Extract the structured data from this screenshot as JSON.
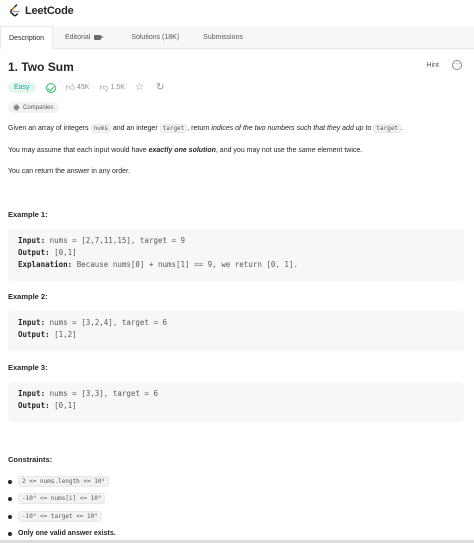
{
  "header": {
    "logo_text": "LeetCode"
  },
  "tabs": [
    {
      "label": "Description"
    },
    {
      "label": "Editorial"
    },
    {
      "label": "Solutions (18K)"
    },
    {
      "label": "Submissions"
    }
  ],
  "problem": {
    "title": "1. Two Sum",
    "hint_label": "Hint",
    "difficulty": "Easy",
    "likes": "45K",
    "dislikes": "1.5K",
    "companies_label": "Companies"
  },
  "description": {
    "p1_a": "Given an array of integers ",
    "p1_code1": "nums",
    "p1_b": " and an integer ",
    "p1_code2": "target",
    "p1_c": ", return ",
    "p1_em": "indices of the two numbers such that they add up to ",
    "p1_code3": "target",
    "p1_d": ".",
    "p2_a": "You may assume that each input would have ",
    "p2_strong": "exactly one solution",
    "p2_b": ", and you may not use the ",
    "p2_em": "same",
    "p2_c": " element twice.",
    "p3": "You can return the answer in any order."
  },
  "examples": [
    {
      "title": "Example 1:",
      "input_label": "Input:",
      "input": " nums = [2,7,11,15], target = 9",
      "output_label": "Output:",
      "output": " [0,1]",
      "explanation_label": "Explanation:",
      "explanation": " Because nums[0] + nums[1] == 9, we return [0, 1]."
    },
    {
      "title": "Example 2:",
      "input_label": "Input:",
      "input": " nums = [3,2,4], target = 6",
      "output_label": "Output:",
      "output": " [1,2]"
    },
    {
      "title": "Example 3:",
      "input_label": "Input:",
      "input": " nums = [3,3], target = 6",
      "output_label": "Output:",
      "output": " [0,1]"
    }
  ],
  "constraints": {
    "title": "Constraints:",
    "items": [
      "2 <= nums.length <= 10⁴",
      "-10⁹ <= nums[i] <= 10⁹",
      "-10⁹ <= target <= 10⁹"
    ],
    "last": "Only one valid answer exists."
  }
}
